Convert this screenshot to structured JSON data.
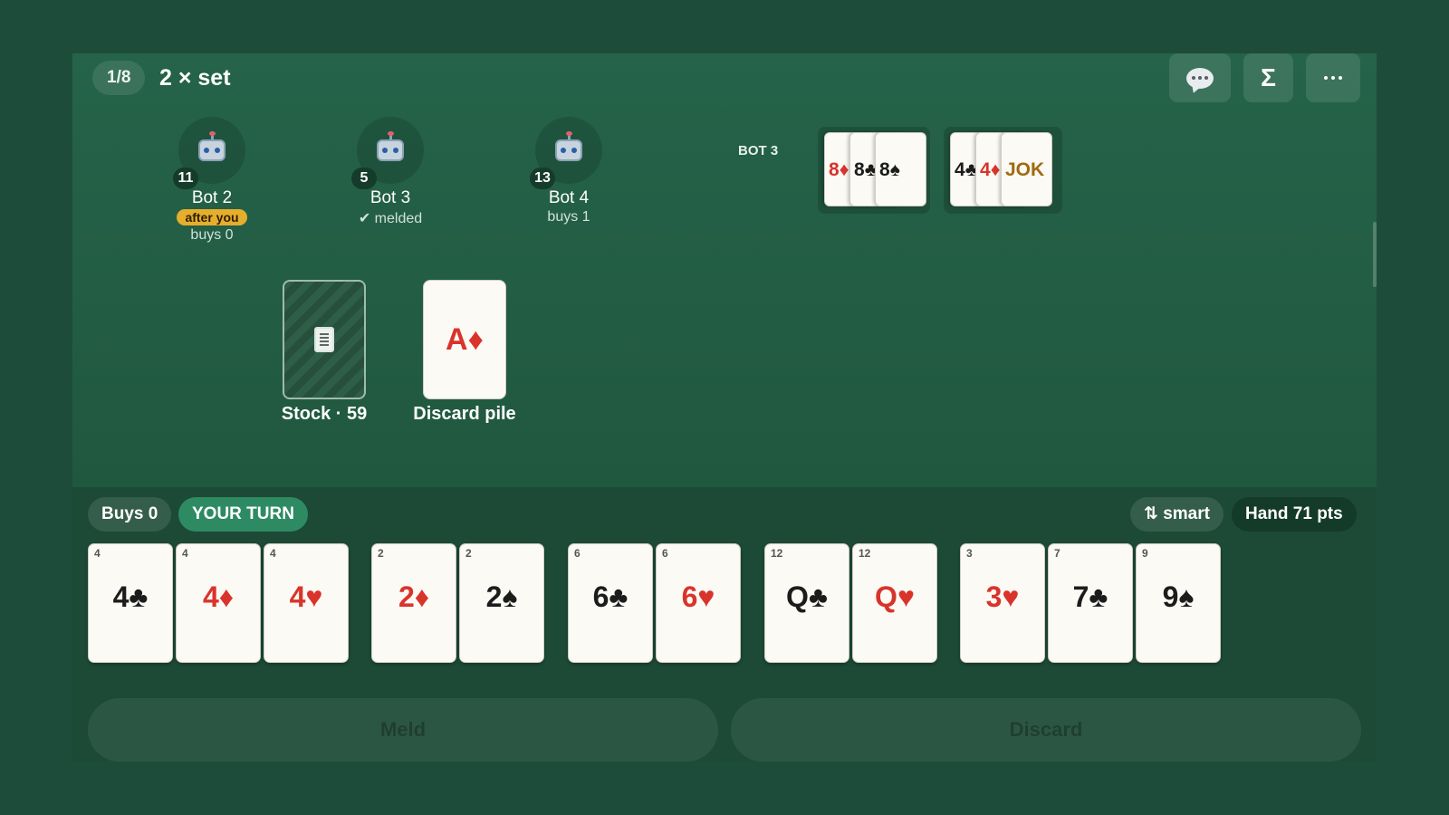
{
  "header": {
    "round": "1/8",
    "contract": "2 × set",
    "chat_icon": "chat-bubble-icon",
    "scores_label": "Σ",
    "more_icon": "more-horizontal-icon"
  },
  "opponents": [
    {
      "name": "Bot 2",
      "cards": "11",
      "tag": "after you",
      "sub": "buys 0"
    },
    {
      "name": "Bot 3",
      "cards": "5",
      "tag": "",
      "sub": "✔ melded"
    },
    {
      "name": "Bot 4",
      "cards": "13",
      "tag": "",
      "sub": "buys 1"
    }
  ],
  "melds": {
    "owner": "BOT 3",
    "groups": [
      [
        {
          "rank": "8",
          "suit": "♦",
          "color": "red"
        },
        {
          "rank": "8",
          "suit": "♣",
          "color": "black"
        },
        {
          "rank": "8",
          "suit": "♠",
          "color": "black"
        }
      ],
      [
        {
          "rank": "4",
          "suit": "♣",
          "color": "black"
        },
        {
          "rank": "4",
          "suit": "♦",
          "color": "red"
        },
        {
          "rank": "JOK",
          "suit": "",
          "color": "gold"
        }
      ]
    ]
  },
  "piles": {
    "stock_label": "Stock · 59",
    "discard_label": "Discard pile",
    "discard_top": {
      "rank": "A",
      "suit": "♦",
      "color": "red"
    }
  },
  "hand": {
    "buys": "Buys 0",
    "turn": "YOUR TURN",
    "sort": "⇅ smart",
    "points": "Hand 71 pts",
    "cards": [
      {
        "pts": "4",
        "rank": "4",
        "suit": "♣",
        "color": "black"
      },
      {
        "pts": "4",
        "rank": "4",
        "suit": "♦",
        "color": "red"
      },
      {
        "pts": "4",
        "rank": "4",
        "suit": "♥",
        "color": "red"
      },
      {
        "pts": "2",
        "rank": "2",
        "suit": "♦",
        "color": "red"
      },
      {
        "pts": "2",
        "rank": "2",
        "suit": "♠",
        "color": "black"
      },
      {
        "pts": "6",
        "rank": "6",
        "suit": "♣",
        "color": "black"
      },
      {
        "pts": "6",
        "rank": "6",
        "suit": "♥",
        "color": "red"
      },
      {
        "pts": "12",
        "rank": "Q",
        "suit": "♣",
        "color": "black"
      },
      {
        "pts": "12",
        "rank": "Q",
        "suit": "♥",
        "color": "red"
      },
      {
        "pts": "3",
        "rank": "3",
        "suit": "♥",
        "color": "red"
      },
      {
        "pts": "7",
        "rank": "7",
        "suit": "♣",
        "color": "black"
      },
      {
        "pts": "9",
        "rank": "9",
        "suit": "♠",
        "color": "black"
      }
    ]
  },
  "actions": {
    "meld": "Meld",
    "discard": "Discard"
  },
  "colors": {
    "table": "#25634a",
    "turn_pill": "#2e8a63",
    "after_you": "#e6ae2d",
    "red_suit": "#d8342c"
  }
}
